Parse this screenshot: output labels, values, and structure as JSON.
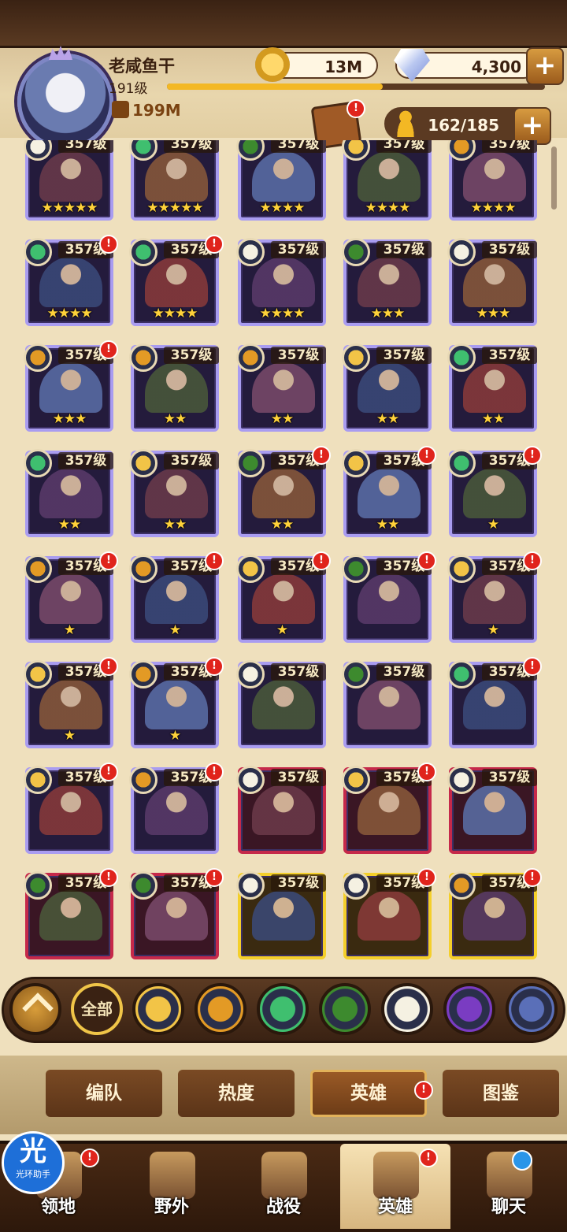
{
  "player": {
    "name": "老咸鱼干",
    "level": "191级",
    "power": "199M"
  },
  "resources": {
    "gold": "13M",
    "gems": "4,300",
    "heroes": "162/185",
    "plus": "+"
  },
  "badge": "!",
  "heroes": [
    {
      "level": "357级",
      "stars": "★★★★★",
      "faction": "celestial",
      "frame": "purple",
      "alert": false
    },
    {
      "level": "357级",
      "stars": "★★★★★",
      "faction": "wilder",
      "frame": "purple",
      "alert": false
    },
    {
      "level": "357级",
      "stars": "★★★★",
      "faction": "graveborn",
      "frame": "purple",
      "alert": false
    },
    {
      "level": "357级",
      "stars": "★★★★",
      "faction": "lightbearer",
      "frame": "purple",
      "alert": false
    },
    {
      "level": "357级",
      "stars": "★★★★",
      "faction": "mauler",
      "frame": "purple",
      "alert": false
    },
    {
      "level": "357级",
      "stars": "★★★★",
      "faction": "wilder",
      "frame": "purple",
      "alert": true
    },
    {
      "level": "357级",
      "stars": "★★★★",
      "faction": "wilder",
      "frame": "purple",
      "alert": true
    },
    {
      "level": "357级",
      "stars": "★★★★",
      "faction": "celestial",
      "frame": "purple",
      "alert": false
    },
    {
      "level": "357级",
      "stars": "★★★",
      "faction": "graveborn",
      "frame": "purple",
      "alert": false
    },
    {
      "level": "357级",
      "stars": "★★★",
      "faction": "celestial",
      "frame": "purple",
      "alert": false
    },
    {
      "level": "357级",
      "stars": "★★★",
      "faction": "mauler",
      "frame": "purple",
      "alert": true
    },
    {
      "level": "357级",
      "stars": "★★",
      "faction": "mauler",
      "frame": "purple",
      "alert": false
    },
    {
      "level": "357级",
      "stars": "★★",
      "faction": "mauler",
      "frame": "purple",
      "alert": false
    },
    {
      "level": "357级",
      "stars": "★★",
      "faction": "lightbearer",
      "frame": "purple",
      "alert": false
    },
    {
      "level": "357级",
      "stars": "★★",
      "faction": "wilder",
      "frame": "purple",
      "alert": false
    },
    {
      "level": "357级",
      "stars": "★★",
      "faction": "wilder",
      "frame": "purple",
      "alert": false
    },
    {
      "level": "357级",
      "stars": "★★",
      "faction": "lightbearer",
      "frame": "purple",
      "alert": false
    },
    {
      "level": "357级",
      "stars": "★★",
      "faction": "graveborn",
      "frame": "purple",
      "alert": true
    },
    {
      "level": "357级",
      "stars": "★★",
      "faction": "lightbearer",
      "frame": "purple",
      "alert": true
    },
    {
      "level": "357级",
      "stars": "★",
      "faction": "wilder",
      "frame": "purple",
      "alert": true
    },
    {
      "level": "357级",
      "stars": "★",
      "faction": "mauler",
      "frame": "purple",
      "alert": true
    },
    {
      "level": "357级",
      "stars": "★",
      "faction": "mauler",
      "frame": "purple",
      "alert": true
    },
    {
      "level": "357级",
      "stars": "★",
      "faction": "lightbearer",
      "frame": "purple",
      "alert": true
    },
    {
      "level": "357级",
      "stars": "",
      "faction": "graveborn",
      "frame": "purple",
      "alert": true
    },
    {
      "level": "357级",
      "stars": "★",
      "faction": "lightbearer",
      "frame": "purple",
      "alert": true
    },
    {
      "level": "357级",
      "stars": "★",
      "faction": "lightbearer",
      "frame": "purple",
      "alert": true
    },
    {
      "level": "357级",
      "stars": "★",
      "faction": "mauler",
      "frame": "purple",
      "alert": true
    },
    {
      "level": "357级",
      "stars": "",
      "faction": "celestial",
      "frame": "purple",
      "alert": false
    },
    {
      "level": "357级",
      "stars": "",
      "faction": "graveborn",
      "frame": "purple",
      "alert": false
    },
    {
      "level": "357级",
      "stars": "",
      "faction": "wilder",
      "frame": "purple",
      "alert": true
    },
    {
      "level": "357级",
      "stars": "",
      "faction": "lightbearer",
      "frame": "purple",
      "alert": true
    },
    {
      "level": "357级",
      "stars": "",
      "faction": "mauler",
      "frame": "purple",
      "alert": true
    },
    {
      "level": "357级",
      "stars": "",
      "faction": "celestial",
      "frame": "red",
      "alert": false
    },
    {
      "level": "357级",
      "stars": "",
      "faction": "lightbearer",
      "frame": "red",
      "alert": true
    },
    {
      "level": "357级",
      "stars": "",
      "faction": "celestial",
      "frame": "red",
      "alert": false
    },
    {
      "level": "357级",
      "stars": "",
      "faction": "graveborn",
      "frame": "red",
      "alert": true
    },
    {
      "level": "357级",
      "stars": "",
      "faction": "graveborn",
      "frame": "red",
      "alert": true
    },
    {
      "level": "357级",
      "stars": "",
      "faction": "celestial",
      "frame": "gold",
      "alert": false
    },
    {
      "level": "357级",
      "stars": "",
      "faction": "celestial",
      "frame": "gold",
      "alert": true
    },
    {
      "level": "357级",
      "stars": "",
      "faction": "mauler",
      "frame": "gold",
      "alert": true
    }
  ],
  "filters": {
    "all_label": "全部",
    "factions": [
      "lightbearer",
      "mauler",
      "wilder",
      "graveborn",
      "celestial",
      "hypogean",
      "dimensional"
    ]
  },
  "subtabs": [
    "编队",
    "热度",
    "英雄",
    "图鉴"
  ],
  "nav": [
    "领地",
    "野外",
    "战役",
    "英雄",
    "聊天"
  ],
  "helper": {
    "glyph": "光",
    "label": "光环助手"
  },
  "colors": {
    "lightbearer": "#f2c447",
    "mauler": "#e39a25",
    "wilder": "#3fbf6f",
    "graveborn": "#3d8a2e",
    "celestial": "#f5f1e2",
    "hypogean": "#7a3cc2",
    "dimensional": "#5a6fb8",
    "badge": "#e0241c"
  }
}
